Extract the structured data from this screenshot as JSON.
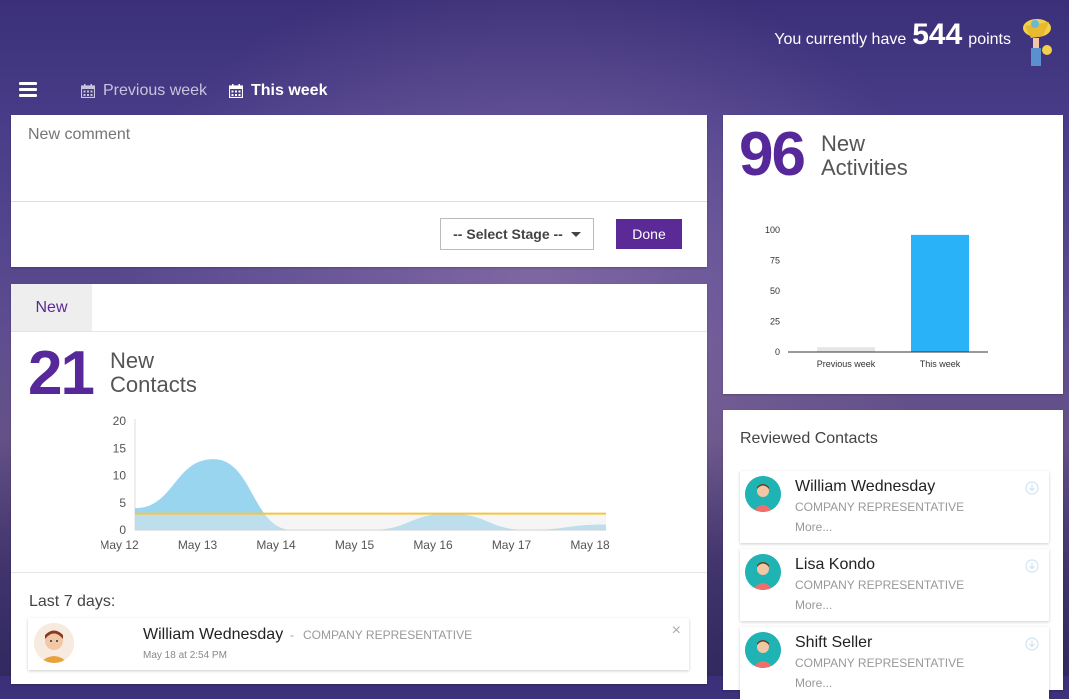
{
  "header": {
    "points_prefix": "You currently have",
    "points_value": "544",
    "points_suffix": "points"
  },
  "nav": {
    "previous_week": "Previous week",
    "this_week": "This week"
  },
  "comment": {
    "placeholder": "New comment",
    "select_stage": "-- Select Stage --",
    "done": "Done"
  },
  "contacts": {
    "tab": "New",
    "count": "21",
    "label_line1": "New",
    "label_line2": "Contacts",
    "last7_label": "Last 7 days:"
  },
  "activity_item": {
    "name": "William Wednesday",
    "dash": "-",
    "role": "COMPANY REPRESENTATIVE",
    "time": "May 18 at 2:54 PM",
    "close": "×"
  },
  "activities": {
    "count": "96",
    "label_line1": "New",
    "label_line2": "Activities"
  },
  "reviewed": {
    "title": "Reviewed Contacts",
    "items": [
      {
        "name": "William Wednesday",
        "role": "COMPANY REPRESENTATIVE",
        "more": "More..."
      },
      {
        "name": "Lisa Kondo",
        "role": "COMPANY REPRESENTATIVE",
        "more": "More..."
      },
      {
        "name": "Shift Seller",
        "role": "COMPANY REPRESENTATIVE",
        "more": "More..."
      }
    ]
  },
  "colors": {
    "brand_purple": "#56289a",
    "area_blue": "#8fd0ee",
    "line_yellow": "#f5c542",
    "bar_blue": "#29b2f7"
  },
  "chart_data": [
    {
      "type": "area",
      "categories": [
        "May 12",
        "May 13",
        "May 14",
        "May 15",
        "May 16",
        "May 17",
        "May 18"
      ],
      "yticks": [
        "0",
        "5",
        "10",
        "15",
        "20"
      ],
      "ylim": [
        0,
        20
      ],
      "series": [
        {
          "values": [
            4,
            13,
            0,
            0,
            3,
            0,
            1
          ]
        },
        {
          "values": [
            3,
            3,
            3,
            3,
            3,
            3,
            3
          ]
        }
      ]
    },
    {
      "type": "bar",
      "categories": [
        "Previous week",
        "This week"
      ],
      "values": [
        4,
        96
      ],
      "yticks": [
        "0",
        "25",
        "50",
        "75",
        "100"
      ],
      "ylim": [
        0,
        100
      ]
    }
  ]
}
